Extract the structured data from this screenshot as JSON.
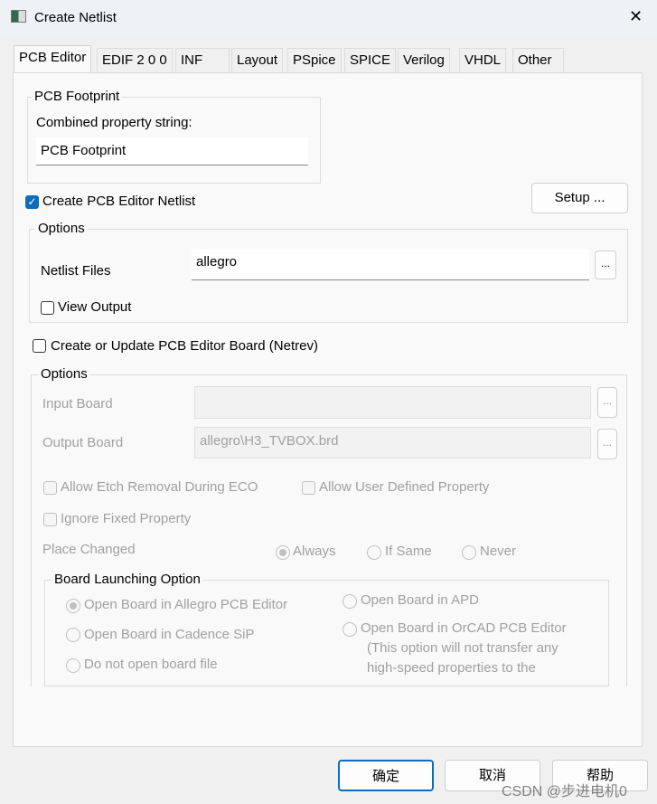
{
  "window": {
    "title": "Create Netlist",
    "close_icon": "close-icon"
  },
  "tabs": [
    "PCB Editor",
    "EDIF 2 0 0",
    "INF",
    "Layout",
    "PSpice",
    "SPICE",
    "Verilog",
    "VHDL",
    "Other"
  ],
  "pcb_footprint": {
    "group_label": "PCB Footprint",
    "field_label": "Combined property string:",
    "value": "PCB Footprint"
  },
  "create_netlist": {
    "label": "Create PCB Editor Netlist",
    "checked": true
  },
  "setup_label": "Setup ...",
  "options1": {
    "label": "Options",
    "netlist_files_label": "Netlist Files",
    "netlist_files_value": "allegro",
    "browse": "...",
    "view_output_label": "View Output",
    "view_output_checked": false
  },
  "create_board": {
    "label": "Create or Update PCB Editor Board (Netrev)",
    "checked": false
  },
  "options2": {
    "label": "Options",
    "input_board_label": "Input Board",
    "input_board_value": "",
    "output_board_label": "Output Board",
    "output_board_value": "allegro\\H3_TVBOX.brd",
    "browse": "...",
    "allow_etch": "Allow Etch Removal During ECO",
    "allow_user": "Allow User Defined Property",
    "ignore_fixed": "Ignore Fixed Property",
    "place_changed_label": "Place Changed",
    "place_always": "Always",
    "place_if_same": "If Same",
    "place_never": "Never",
    "place_selected": "Always"
  },
  "board_launch": {
    "label": "Board Launching Option",
    "allegro": "Open Board in Allegro PCB Editor",
    "sip": "Open Board in Cadence SiP",
    "none": "Do not open board file",
    "apd": "Open Board in APD",
    "orcad": "Open Board in OrCAD PCB Editor",
    "note1": "(This option will not transfer any",
    "note2": "high-speed properties to the",
    "selected": "Open Board in Allegro PCB Editor"
  },
  "buttons": {
    "ok": "确定",
    "cancel": "取消",
    "help": "帮助"
  },
  "watermark": "CSDN @步进电机0"
}
